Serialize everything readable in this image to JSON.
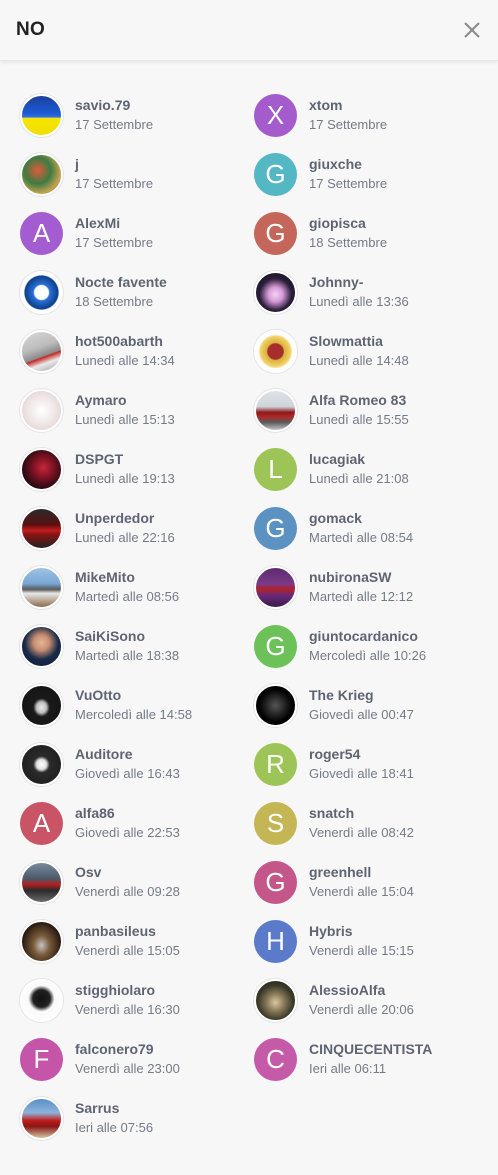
{
  "header": {
    "title": "NO"
  },
  "users": [
    {
      "name": "savio.79",
      "date": "17 Settembre",
      "avatar": {
        "kind": "photo",
        "bg": "linear-gradient(180deg,#1b3f9a 0%,#1d5bd8 45%,#3a72e8 55%,#f5e400 56%,#f2de00 100%)"
      }
    },
    {
      "name": "xtom",
      "date": "17 Settembre",
      "avatar": {
        "kind": "letter",
        "letter": "X",
        "color": "#a45ccc"
      }
    },
    {
      "name": "j",
      "date": "17 Settembre",
      "avatar": {
        "kind": "photo",
        "bg": "radial-gradient(circle at 40% 40%,#e05a3a 0%,#3d7c41 40%,#c7a350 70%,#3a2f20 100%)"
      }
    },
    {
      "name": "giuxche",
      "date": "17 Settembre",
      "avatar": {
        "kind": "letter",
        "letter": "G",
        "color": "#53b8c4"
      }
    },
    {
      "name": "AlexMi",
      "date": "17 Settembre",
      "avatar": {
        "kind": "letter",
        "letter": "A",
        "color": "#a35dd1"
      }
    },
    {
      "name": "giopisca",
      "date": "18 Settembre",
      "avatar": {
        "kind": "letter",
        "letter": "G",
        "color": "#c4665a"
      }
    },
    {
      "name": "Nocte favente",
      "date": "18 Settembre",
      "avatar": {
        "kind": "photo",
        "bg": "radial-gradient(circle,#ffffff 0%,#ffffff 25%,#2b6fd6 30%,#0b3f8a 60%,#ffffff 64%,#ffffff 100%)"
      }
    },
    {
      "name": "Johnny-",
      "date": "Lunedì alle 13:36",
      "avatar": {
        "kind": "photo",
        "bg": "radial-gradient(circle at 50% 55%,#f3d3ef 0%,#d89ad8 25%,#2a1e3a 55%,#120c1c 100%)"
      }
    },
    {
      "name": "hot500abarth",
      "date": "Lunedì alle 14:34",
      "avatar": {
        "kind": "photo",
        "bg": "linear-gradient(160deg,#d9d9d9 0%,#bcbcbc 40%,#8a8a8a 60%,#c52626 62%,#eaeaea 75%,#9a9a9a 100%)"
      }
    },
    {
      "name": "Slowmattia",
      "date": "Lunedì alle 14:48",
      "avatar": {
        "kind": "photo",
        "bg": "radial-gradient(circle,#a82d2d 0%,#a82d2d 28%,#d9b23b 32%,#f3d26a 55%,#ffffff 62%,#ffffff 100%)"
      }
    },
    {
      "name": "Aymaro",
      "date": "Lunedì alle 15:13",
      "avatar": {
        "kind": "photo",
        "bg": "radial-gradient(circle,#ffffff 0%,#f0e6e6 50%,#d9c8c8 100%)"
      }
    },
    {
      "name": "Alfa Romeo 83",
      "date": "Lunedì alle 15:55",
      "avatar": {
        "kind": "photo",
        "bg": "linear-gradient(180deg,#dfe3e8 0%,#cfd4da 40%,#8b1a1a 55%,#b32424 65%,#5a5a5a 80%,#bfc3c7 100%)"
      }
    },
    {
      "name": "DSPGT",
      "date": "Lunedì alle 19:13",
      "avatar": {
        "kind": "photo",
        "bg": "radial-gradient(circle at 55% 45%,#c9263a 0%,#7a1222 35%,#1b0a0e 75%,#000 100%)"
      }
    },
    {
      "name": "lucagiak",
      "date": "Lunedì alle 21:08",
      "avatar": {
        "kind": "letter",
        "letter": "L",
        "color": "#9cc457"
      }
    },
    {
      "name": "Unperdedor",
      "date": "Lunedì alle 22:16",
      "avatar": {
        "kind": "photo",
        "bg": "linear-gradient(180deg,#2a2a2a 0%,#5a1010 40%,#c21d1d 55%,#8a1414 65%,#222 100%)"
      }
    },
    {
      "name": "gomack",
      "date": "Martedì alle 08:54",
      "avatar": {
        "kind": "letter",
        "letter": "G",
        "color": "#5b92c2"
      }
    },
    {
      "name": "MikeMito",
      "date": "Martedì alle 08:56",
      "avatar": {
        "kind": "photo",
        "bg": "linear-gradient(180deg,#9fc2e3 0%,#7aa6d4 40%,#5a5a5a 55%,#e8e8e8 65%,#8a6a4a 100%)"
      }
    },
    {
      "name": "nubironaSW",
      "date": "Martedì alle 12:12",
      "avatar": {
        "kind": "photo",
        "bg": "linear-gradient(180deg,#5b2a6e 0%,#7a3a8a 40%,#b0202a 55%,#6a2a7a 70%,#3a1a4a 100%)"
      }
    },
    {
      "name": "SaiKiSono",
      "date": "Martedì alle 18:38",
      "avatar": {
        "kind": "photo",
        "bg": "radial-gradient(circle at 50% 40%,#e3b59a 0%,#c98f70 25%,#1a2a4a 55%,#0d1a33 100%)"
      }
    },
    {
      "name": "giuntocardanico",
      "date": "Mercoledì alle 10:26",
      "avatar": {
        "kind": "letter",
        "letter": "G",
        "color": "#6cc158"
      }
    },
    {
      "name": "VuOtto",
      "date": "Mercoledì alle 14:58",
      "avatar": {
        "kind": "photo",
        "bg": "radial-gradient(ellipse at 50% 55%,#e8e8e8 0%,#bfbfbf 18%,#1a1a1a 30%,#111 100%)"
      }
    },
    {
      "name": "The Krieg",
      "date": "Giovedì alle 00:47",
      "avatar": {
        "kind": "photo",
        "bg": "radial-gradient(circle at 50% 50%,#555 0%,#2a2a2a 30%,#000 60%,#000 100%)"
      }
    },
    {
      "name": "Auditore",
      "date": "Giovedì alle 16:43",
      "avatar": {
        "kind": "photo",
        "bg": "radial-gradient(circle,#ffffff 0%,#e0e0e0 18%,#2a2a2a 30%,#1a1a1a 100%)"
      }
    },
    {
      "name": "roger54",
      "date": "Giovedì alle 18:41",
      "avatar": {
        "kind": "letter",
        "letter": "R",
        "color": "#9cc457"
      }
    },
    {
      "name": "alfa86",
      "date": "Giovedì alle 22:53",
      "avatar": {
        "kind": "letter",
        "letter": "A",
        "color": "#c95466"
      }
    },
    {
      "name": "snatch",
      "date": "Venerdì alle 08:42",
      "avatar": {
        "kind": "letter",
        "letter": "S",
        "color": "#c4b654"
      }
    },
    {
      "name": "Osv",
      "date": "Venerdì alle 09:28",
      "avatar": {
        "kind": "photo",
        "bg": "linear-gradient(180deg,#7a8a9a 0%,#4a5a6a 40%,#b12020 55%,#2a2a2a 70%,#6a6a6a 100%)"
      }
    },
    {
      "name": "greenhell",
      "date": "Venerdì alle 15:04",
      "avatar": {
        "kind": "letter",
        "letter": "G",
        "color": "#c45689"
      }
    },
    {
      "name": "panbasileus",
      "date": "Venerdì alle 15:05",
      "avatar": {
        "kind": "photo",
        "bg": "radial-gradient(ellipse at 50% 60%,#c4c4c4 0%,#7a5a3a 30%,#2a1a10 70%,#000 100%)"
      }
    },
    {
      "name": "Hybris",
      "date": "Venerdì alle 15:15",
      "avatar": {
        "kind": "letter",
        "letter": "H",
        "color": "#5b7ac9"
      }
    },
    {
      "name": "stigghiolaro",
      "date": "Venerdì alle 16:30",
      "avatar": {
        "kind": "photo",
        "bg": "radial-gradient(circle at 50% 45%,#111 0%,#222 30%,#fafafa 45%,#ffffff 100%)"
      }
    },
    {
      "name": "AlessioAlfa",
      "date": "Venerdì alle 20:06",
      "avatar": {
        "kind": "photo",
        "bg": "radial-gradient(circle at 50% 55%,#d9c9a0 0%,#8a7a5a 30%,#3a3a2a 60%,#1a1a10 100%)"
      }
    },
    {
      "name": "falconero79",
      "date": "Venerdì alle 23:00",
      "avatar": {
        "kind": "letter",
        "letter": "F",
        "color": "#c455a8"
      }
    },
    {
      "name": "CINQUECENTISTA",
      "date": "Ieri alle 06:11",
      "avatar": {
        "kind": "letter",
        "letter": "C",
        "color": "#c45aa8"
      }
    },
    {
      "name": "Sarrus",
      "date": "Ieri alle 07:56",
      "avatar": {
        "kind": "photo",
        "bg": "linear-gradient(180deg,#5a8fc4 0%,#8ab4dc 35%,#c21d1d 55%,#8a1414 70%,#d4c4a4 100%)"
      }
    }
  ]
}
